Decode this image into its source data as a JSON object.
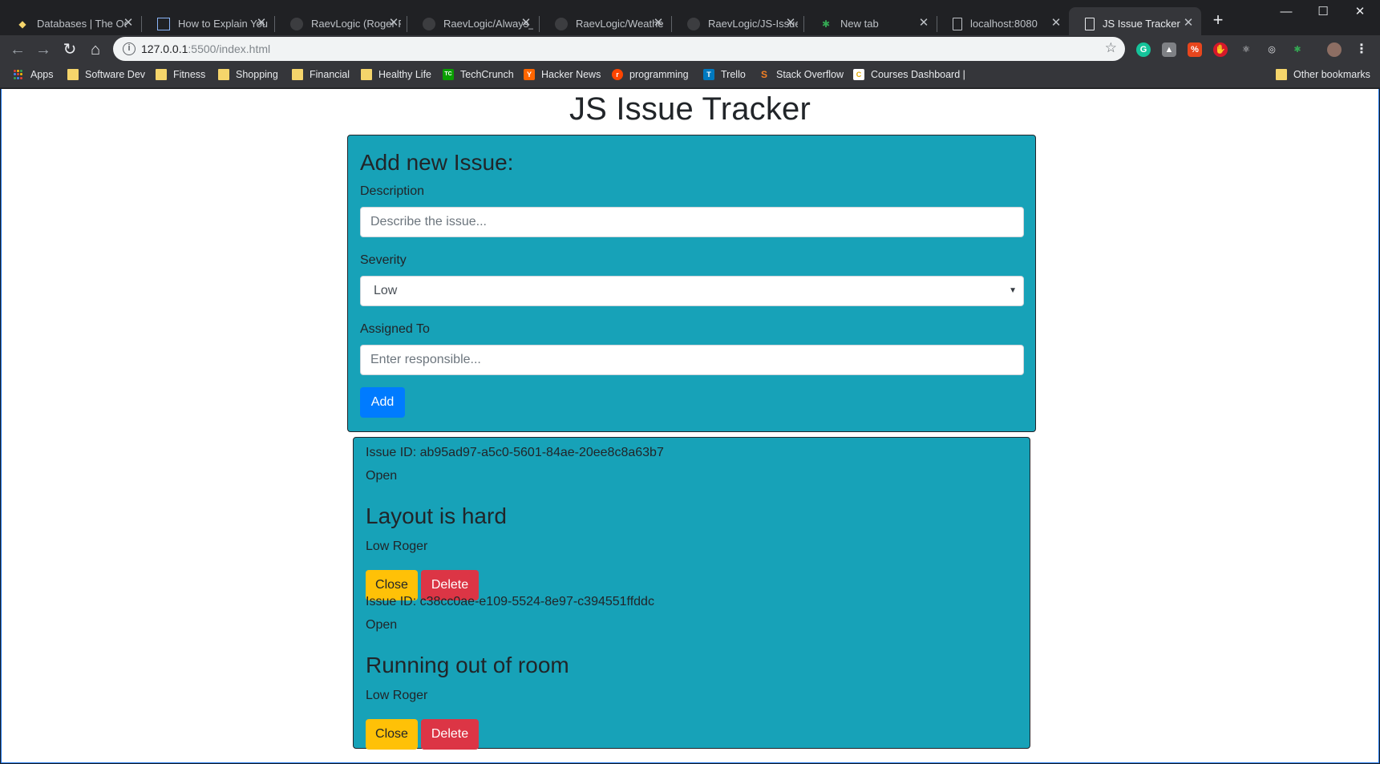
{
  "browser": {
    "tabs": [
      {
        "title": "Databases | The Od",
        "icon": "odin-icon"
      },
      {
        "title": "How to Explain You",
        "icon": "grid-icon"
      },
      {
        "title": "RaevLogic (Roger F",
        "icon": "github-icon"
      },
      {
        "title": "RaevLogic/Always_",
        "icon": "github-icon"
      },
      {
        "title": "RaevLogic/Weathe",
        "icon": "github-icon"
      },
      {
        "title": "RaevLogic/JS-Issue",
        "icon": "github-icon"
      },
      {
        "title": "New tab",
        "icon": "tri-color-icon"
      },
      {
        "title": "localhost:8080",
        "icon": "page-icon"
      },
      {
        "title": "JS Issue Tracker",
        "icon": "page-icon",
        "active": true
      }
    ],
    "url_host": "127.0.0.1",
    "url_rest": ":5500/index.html",
    "bookmarks": [
      {
        "label": "Apps",
        "type": "apps"
      },
      {
        "label": "Software Dev",
        "type": "folder"
      },
      {
        "label": "Fitness",
        "type": "folder"
      },
      {
        "label": "Shopping",
        "type": "folder"
      },
      {
        "label": "Financial",
        "type": "folder"
      },
      {
        "label": "Healthy Life",
        "type": "folder"
      },
      {
        "label": "TechCrunch",
        "type": "site",
        "color": "#0a9e01",
        "glyph": "TC"
      },
      {
        "label": "Hacker News",
        "type": "site",
        "color": "#ff6600",
        "glyph": "Y"
      },
      {
        "label": "programming",
        "type": "site",
        "color": "#ff4500",
        "glyph": "r"
      },
      {
        "label": "Trello",
        "type": "site",
        "color": "#0079bf",
        "glyph": "T"
      },
      {
        "label": "Stack Overflow",
        "type": "site",
        "color": "#f48024",
        "glyph": "S"
      },
      {
        "label": "Courses Dashboard |",
        "type": "site",
        "color": "#ffffff",
        "glyph": "C"
      }
    ],
    "other_bookmarks": "Other bookmarks"
  },
  "app": {
    "title": "JS Issue Tracker",
    "form": {
      "heading": "Add new Issue:",
      "description_label": "Description",
      "description_placeholder": "Describe the issue...",
      "severity_label": "Severity",
      "severity_value": "Low",
      "assigned_label": "Assigned To",
      "assigned_placeholder": "Enter responsible...",
      "add_label": "Add"
    },
    "issues": [
      {
        "id_text": "Issue ID: ab95ad97-a5c0-5601-84ae-20ee8c8a63b7",
        "status": "Open",
        "description": "Layout is hard",
        "meta": "Low Roger",
        "close_label": "Close",
        "delete_label": "Delete"
      },
      {
        "id_text": "Issue ID: c38cc0ae-e109-5524-8e97-c394551ffddc",
        "status": "Open",
        "description": "Running out of room",
        "meta": "Low Roger",
        "close_label": "Close",
        "delete_label": "Delete"
      }
    ]
  },
  "colors": {
    "panel": "#17a2b8",
    "primary": "#007bff",
    "warning": "#ffc107",
    "danger": "#dc3545"
  }
}
